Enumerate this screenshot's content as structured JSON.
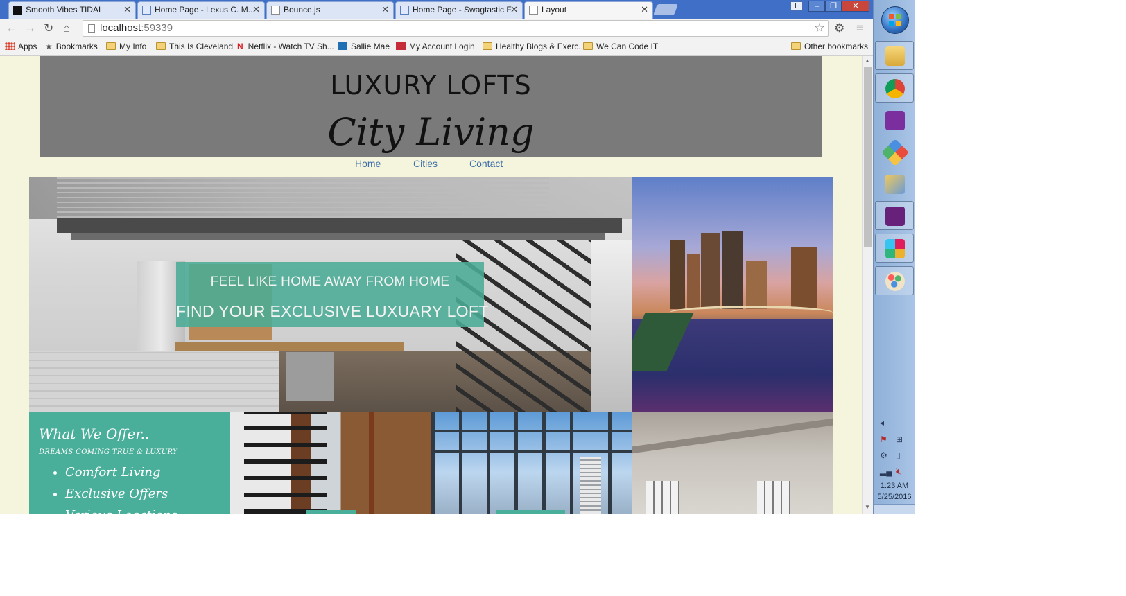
{
  "browser": {
    "tabs": [
      {
        "title": "Smooth Vibes TIDAL",
        "icon": "tidal-icon"
      },
      {
        "title": "Home Page - Lexus C. M...",
        "icon": "page-icon"
      },
      {
        "title": "Bounce.js",
        "icon": "page-icon"
      },
      {
        "title": "Home Page - Swagtastic F...",
        "icon": "page-icon"
      },
      {
        "title": "Layout",
        "icon": "page-icon"
      }
    ],
    "window_controls": {
      "user": "L",
      "minimize": "–",
      "maximize": "❐",
      "close": "✕"
    },
    "address": {
      "host": "localhost",
      "port": ":59339"
    },
    "bookmarks": [
      {
        "label": "Apps",
        "icon": "apps-grid-icon"
      },
      {
        "label": "Bookmarks",
        "icon": "star-icon"
      },
      {
        "label": "My Info",
        "icon": "folder-icon"
      },
      {
        "label": "This Is Cleveland",
        "icon": "folder-icon"
      },
      {
        "label": "Netflix - Watch TV Sh...",
        "icon": "netflix-icon"
      },
      {
        "label": "Sallie Mae",
        "icon": "salliemae-icon"
      },
      {
        "label": "My Account Login",
        "icon": "account-icon"
      },
      {
        "label": "Healthy Blogs & Exerc...",
        "icon": "folder-icon"
      },
      {
        "label": "We Can Code IT",
        "icon": "folder-icon"
      }
    ],
    "other_bookmarks": "Other bookmarks"
  },
  "site": {
    "title": "LUXURY LOFTS",
    "subtitle": "City Living",
    "nav": [
      "Home",
      "Cities",
      "Contact"
    ],
    "hero": {
      "line1": "FEEL LIKE HOME AWAY FROM HOME",
      "line2": "FIND YOUR EXCLUSIVE LUXUARY LOFT"
    },
    "offer": {
      "heading": "What We Offer..",
      "tagline": "DREAMS COMING TRUE & LUXURY",
      "items": [
        "Comfort Living",
        "Exclusive Offers",
        "Various Locations"
      ]
    }
  },
  "taskbar": {
    "time": "1:23 AM",
    "date": "5/25/2016",
    "apps": [
      "file-explorer-icon",
      "chrome-icon",
      "onenote-icon",
      "photo-app-icon",
      "snipping-tool-icon",
      "visual-studio-icon",
      "slack-icon",
      "paint-icon"
    ]
  },
  "colors": {
    "page_bg": "#f5f4dd",
    "header_bg": "#7a7a7a",
    "accent_teal": "#4aaf9a",
    "nav_link": "#3d6fa8"
  }
}
